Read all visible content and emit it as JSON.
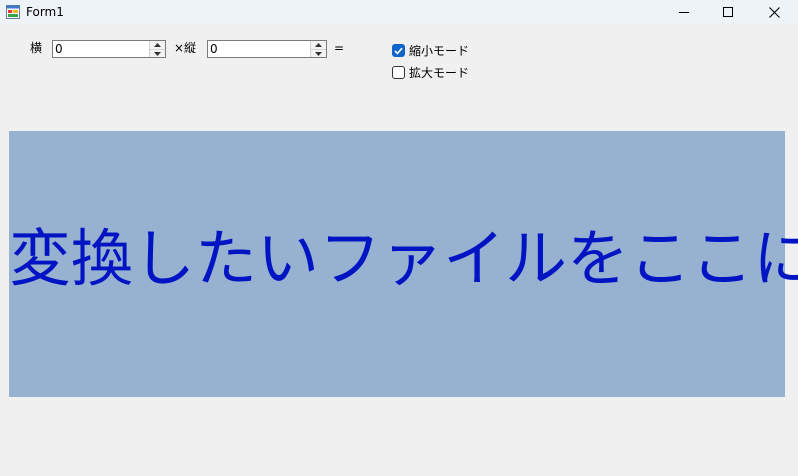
{
  "window": {
    "title": "Form1",
    "icons": {
      "app": "form-app-icon",
      "minimize": "minimize-icon",
      "maximize": "maximize-icon",
      "close": "close-icon"
    }
  },
  "size_inputs": {
    "width_label": "横",
    "width_value": "0",
    "times_height_label": "×縦",
    "height_value": "0",
    "equals_label": "="
  },
  "modes": {
    "shrink": {
      "label": "縮小モード",
      "checked": true
    },
    "enlarge": {
      "label": "拡大モード",
      "checked": false
    }
  },
  "drop_area": {
    "text": "変換したいファイルをここに",
    "background": "#97b2d0",
    "text_color": "#0014c4"
  },
  "colors": {
    "checkbox_accent": "#0f65c9",
    "titlebar": "#eef3f8",
    "window_bg": "#f0f0f0"
  }
}
